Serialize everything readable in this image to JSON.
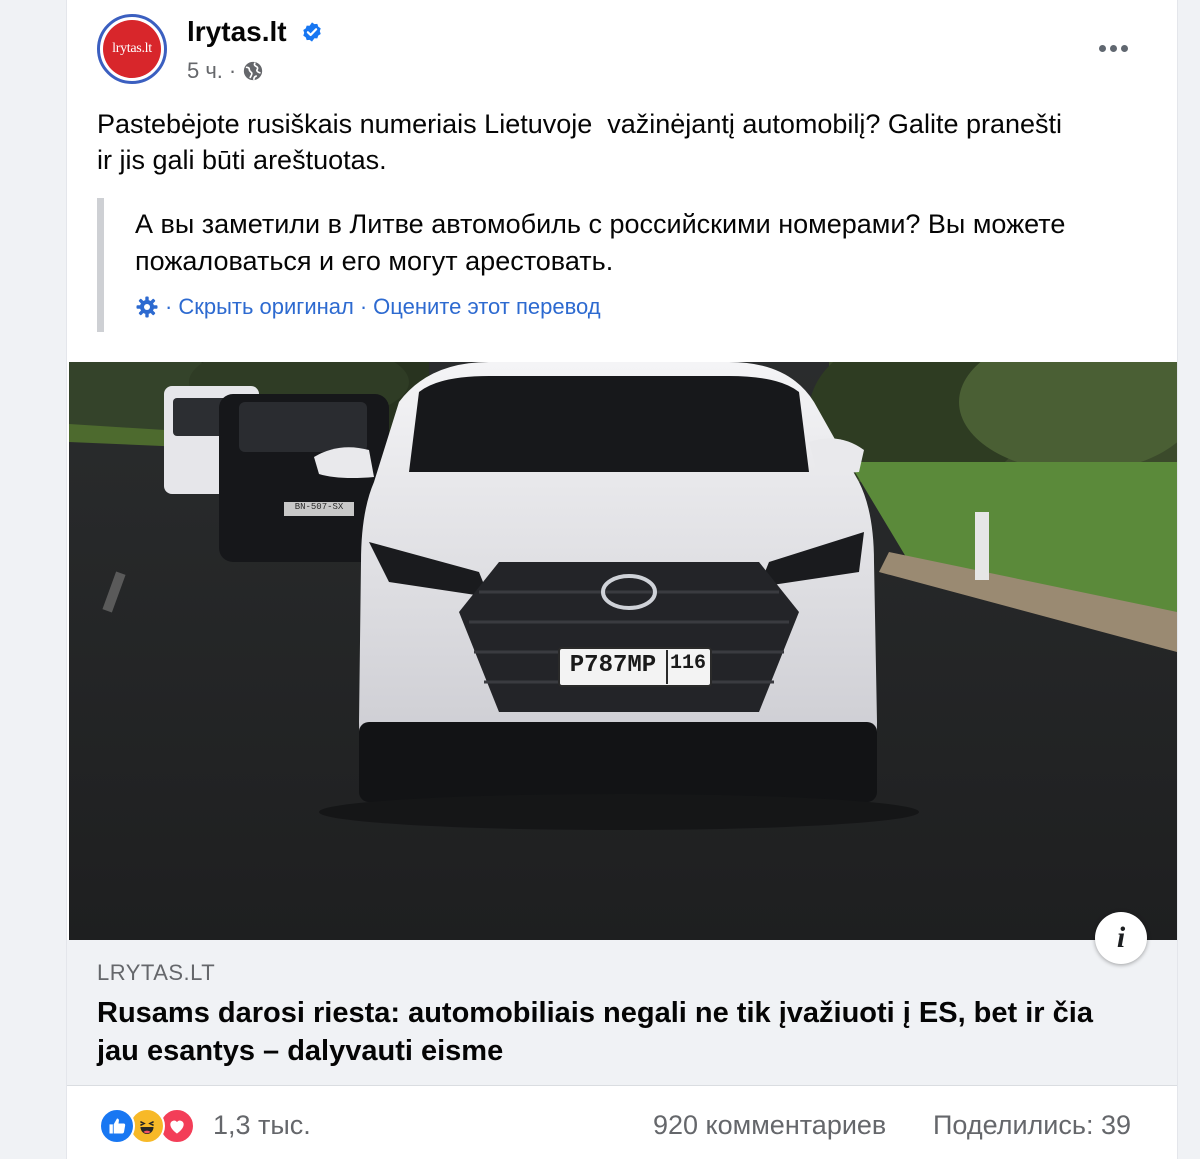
{
  "post": {
    "page_name": "lrytas.lt",
    "avatar_text": "lrytas.lt",
    "time": "5 ч.",
    "separator": "·",
    "text": "Pastebėjote rusiškais numeriais Lietuvoje  važinėjantį automobilį? Galite pranešti\nir jis gali būti areštuotas.",
    "translation": {
      "text": "А вы заметили в Литве автомобиль с российскими номерами? Вы можете пожаловаться и его могут арестовать.",
      "sep1": "·",
      "hide_original": "Скрыть оригинал",
      "sep2": "·",
      "rate": "Оцените этот перевод"
    },
    "photo": {
      "plate": "P787MP",
      "region": "116",
      "small_plate": "BN-507-SX"
    },
    "link": {
      "domain": "LRYTAS.LT",
      "title": "Rusams darosi riesta: automobiliais negali ne tik įvažiuoti į ES, bet ir čia jau esantys – dalyvauti eisme"
    },
    "footer": {
      "reaction_count": "1,3 тыс.",
      "comments": "920 комментариев",
      "shares": "Поделились: 39"
    }
  },
  "icons": {
    "verified": "verified-badge-icon",
    "globe": "globe-icon",
    "more": "more-options-icon",
    "gear": "gear-icon",
    "info": "info-icon",
    "reactions": [
      "like-icon",
      "haha-icon",
      "love-icon"
    ]
  },
  "colors": {
    "link_blue": "#2d6ad0",
    "verified_blue": "#1877f2",
    "brand_red": "#d8262b",
    "muted": "#65676b"
  }
}
